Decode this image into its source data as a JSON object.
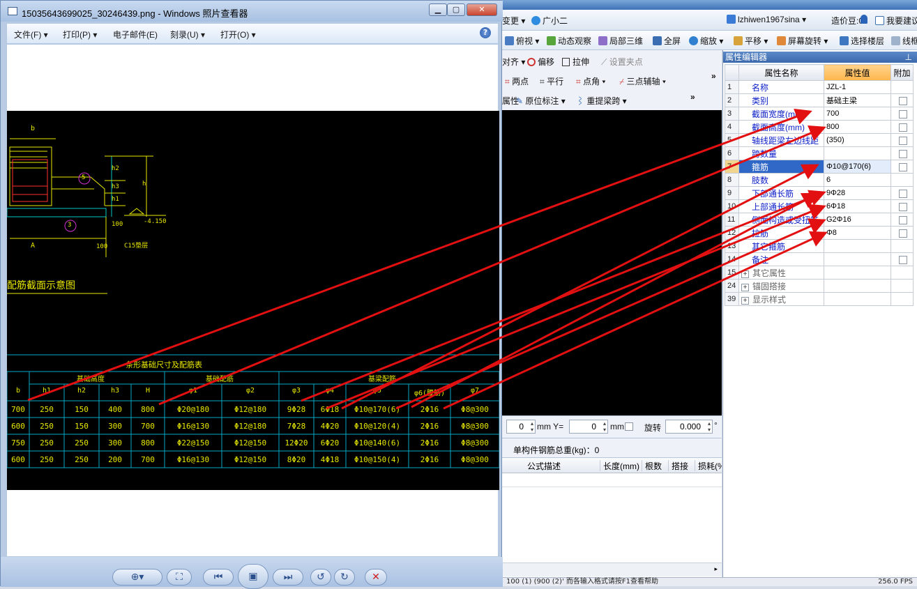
{
  "viewer": {
    "title": "15035643699025_30246439.png - Windows 照片查看器",
    "menu": [
      {
        "label": "文件(F)",
        "caret": true
      },
      {
        "label": "打印(P)",
        "caret": true
      },
      {
        "label": "电子邮件(E)",
        "caret": false
      },
      {
        "label": "刻录(U)",
        "caret": true
      },
      {
        "label": "打开(O)",
        "caret": true
      }
    ],
    "help_label": "?"
  },
  "drawing": {
    "section_title": "配筋截面示意图",
    "labels": {
      "b": "b",
      "h": "h",
      "h1": "h1",
      "h2": "h2",
      "h3": "h3",
      "A": "A",
      "d100a": "100",
      "d100b": "100",
      "elev": "-4.150",
      "c15": "C15垫层",
      "m5": "5",
      "m3": "3"
    },
    "table_title": "条形基础尺寸及配筋表",
    "group_headers": [
      "基础高度",
      "基础配筋",
      "基梁配筋"
    ],
    "columns": [
      "b",
      "h1",
      "h2",
      "h3",
      "H",
      "φ1",
      "φ2",
      "φ3",
      "φ4",
      "φ5",
      "φ6(腰筋)",
      "φ7"
    ],
    "rows": [
      [
        "700",
        "250",
        "150",
        "400",
        "800",
        "Φ20@180",
        "Φ12@180",
        "9Φ28",
        "6Φ18",
        "Φ10@170(6)",
        "2Φ16",
        "Φ8@300"
      ],
      [
        "600",
        "250",
        "150",
        "300",
        "700",
        "Φ16@130",
        "Φ12@180",
        "7Φ28",
        "4Φ20",
        "Φ10@120(4)",
        "2Φ16",
        "Φ8@300"
      ],
      [
        "750",
        "250",
        "250",
        "300",
        "800",
        "Φ22@150",
        "Φ12@150",
        "12Φ20",
        "6Φ20",
        "Φ10@140(6)",
        "2Φ16",
        "Φ8@300"
      ],
      [
        "600",
        "250",
        "250",
        "200",
        "700",
        "Φ16@130",
        "Φ12@150",
        "8Φ20",
        "4Φ18",
        "Φ10@150(4)",
        "2Φ16",
        "Φ8@300"
      ]
    ]
  },
  "app": {
    "menu_items": [
      "变更 ▾",
      "广小二",
      "lzhiwen1967sina ▾",
      "造价豆:0",
      "我要建议"
    ],
    "toolbar": [
      "俯视 ▾",
      "动态观察",
      "局部三维",
      "全屏",
      "缩放 ▾",
      "平移 ▾",
      "屏幕旋转 ▾",
      "选择楼层",
      "线框"
    ],
    "draw_tools_1": [
      "对齐 ▾",
      "偏移",
      "拉伸",
      "设置夹点"
    ],
    "draw_tools_2": [
      "两点",
      "平行",
      "点角 ▾",
      "三点辅轴 ▾"
    ],
    "draw_tools_3": [
      "属性",
      "原位标注 ▾",
      "重提梁跨 ▾"
    ],
    "more": "»",
    "coord": {
      "x_value": "0",
      "x_unit": "mm Y=",
      "y_value": "0",
      "y_unit": "mm",
      "rotate_label": "旋转",
      "rotate_value": "0.000",
      "deg": "°"
    },
    "weight_label": "单构件钢筋总重(kg)：0",
    "formula_headers": [
      "公式描述",
      "长度(mm)",
      "根数",
      "搭接",
      "损耗(%)"
    ],
    "status_text": "100 (1) (900 (2)' 而各输入格式请按F1查看帮助",
    "status_right": "256.0 FPS"
  },
  "property_editor": {
    "title": "属性编辑器",
    "pin": "⊥",
    "headers": {
      "name": "属性名称",
      "value": "属性值",
      "extra": "附加"
    },
    "rows": [
      {
        "no": "1",
        "name": "名称",
        "value": "JZL-1",
        "check": false,
        "type": "item"
      },
      {
        "no": "2",
        "name": "类别",
        "value": "基础主梁",
        "check": true,
        "type": "item"
      },
      {
        "no": "3",
        "name": "截面宽度(mm)",
        "value": "700",
        "check": true,
        "type": "item"
      },
      {
        "no": "4",
        "name": "截面高度(mm)",
        "value": "800",
        "check": true,
        "type": "item"
      },
      {
        "no": "5",
        "name": "轴线距梁左边线距",
        "value": "(350)",
        "check": true,
        "type": "item"
      },
      {
        "no": "6",
        "name": "跨数量",
        "value": "",
        "check": true,
        "type": "item"
      },
      {
        "no": "7",
        "name": "箍筋",
        "value": "Φ10@170(6)",
        "check": true,
        "type": "selected"
      },
      {
        "no": "8",
        "name": "肢数",
        "value": "6",
        "check": false,
        "type": "item"
      },
      {
        "no": "9",
        "name": "下部通长筋",
        "value": "9Φ28",
        "check": true,
        "type": "item"
      },
      {
        "no": "10",
        "name": "上部通长筋",
        "value": "6Φ18",
        "check": true,
        "type": "item"
      },
      {
        "no": "11",
        "name": "侧面构造或受扭筋",
        "value": "G2Φ16",
        "check": true,
        "type": "item"
      },
      {
        "no": "12",
        "name": "拉筋",
        "value": "Φ8",
        "check": true,
        "type": "item"
      },
      {
        "no": "13",
        "name": "其它箍筋",
        "value": "",
        "check": false,
        "type": "item"
      },
      {
        "no": "14",
        "name": "备注",
        "value": "",
        "check": true,
        "type": "item"
      },
      {
        "no": "15",
        "name": "其它属性",
        "value": "",
        "check": false,
        "type": "group"
      },
      {
        "no": "24",
        "name": "锚固搭接",
        "value": "",
        "check": false,
        "type": "group"
      },
      {
        "no": "39",
        "name": "显示样式",
        "value": "",
        "check": false,
        "type": "group"
      }
    ]
  },
  "colors": {
    "annotation_arrow": "#e21010",
    "cad_text": "#e8e800",
    "cad_line": "#00c8c8",
    "cad_green": "#2fe02f",
    "selected_row": "#2f68c7",
    "value_header": "#ffb64d"
  }
}
